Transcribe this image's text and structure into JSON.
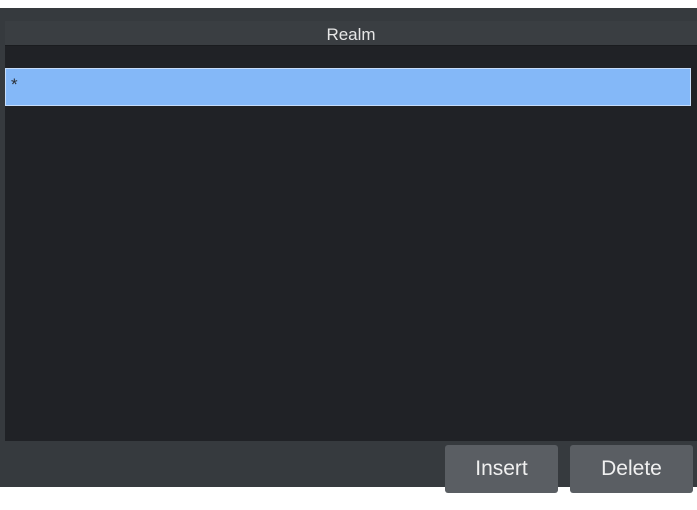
{
  "table": {
    "columns": [
      "Realm"
    ],
    "rows": [
      {
        "realm": "*",
        "selected": true
      }
    ]
  },
  "buttons": {
    "insert_label": "Insert",
    "delete_label": "Delete"
  },
  "colors": {
    "background": "#363a3e",
    "table_background": "#202226",
    "selected_row": "#84b8f8",
    "button": "#5a5e63"
  }
}
